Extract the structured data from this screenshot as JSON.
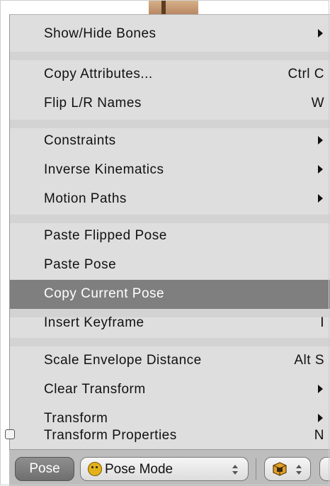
{
  "menu": {
    "items": [
      {
        "label": "Show/Hide Bones",
        "shortcut": "",
        "submenu": true
      },
      {
        "label": "Copy Attributes...",
        "shortcut": "Ctrl C",
        "submenu": false
      },
      {
        "label": "Flip L/R Names",
        "shortcut": "W",
        "submenu": false
      },
      {
        "label": "Constraints",
        "shortcut": "",
        "submenu": true
      },
      {
        "label": "Inverse Kinematics",
        "shortcut": "",
        "submenu": true
      },
      {
        "label": "Motion Paths",
        "shortcut": "",
        "submenu": true
      },
      {
        "label": "Paste Flipped Pose",
        "shortcut": "",
        "submenu": false
      },
      {
        "label": "Paste Pose",
        "shortcut": "",
        "submenu": false
      },
      {
        "label": "Copy Current Pose",
        "shortcut": "",
        "submenu": false,
        "highlighted": true
      },
      {
        "label": "Insert Keyframe",
        "shortcut": "I",
        "submenu": false
      },
      {
        "label": "Scale Envelope Distance",
        "shortcut": "Alt S",
        "submenu": false
      },
      {
        "label": "Clear Transform",
        "shortcut": "",
        "submenu": true
      },
      {
        "label": "Transform",
        "shortcut": "",
        "submenu": true
      },
      {
        "label": "Transform Properties",
        "shortcut": "N",
        "submenu": false,
        "checkbox": true
      }
    ]
  },
  "header": {
    "pose_menu_label": "Pose",
    "mode_label": "Pose Mode",
    "mode_icon": "pose-mode-icon",
    "pivot_icon": "pivot-cube-icon"
  },
  "colors": {
    "menu_bg": "#dedede",
    "highlight_bg": "#7f7f7f",
    "header_bg": "#bdbdbd"
  }
}
